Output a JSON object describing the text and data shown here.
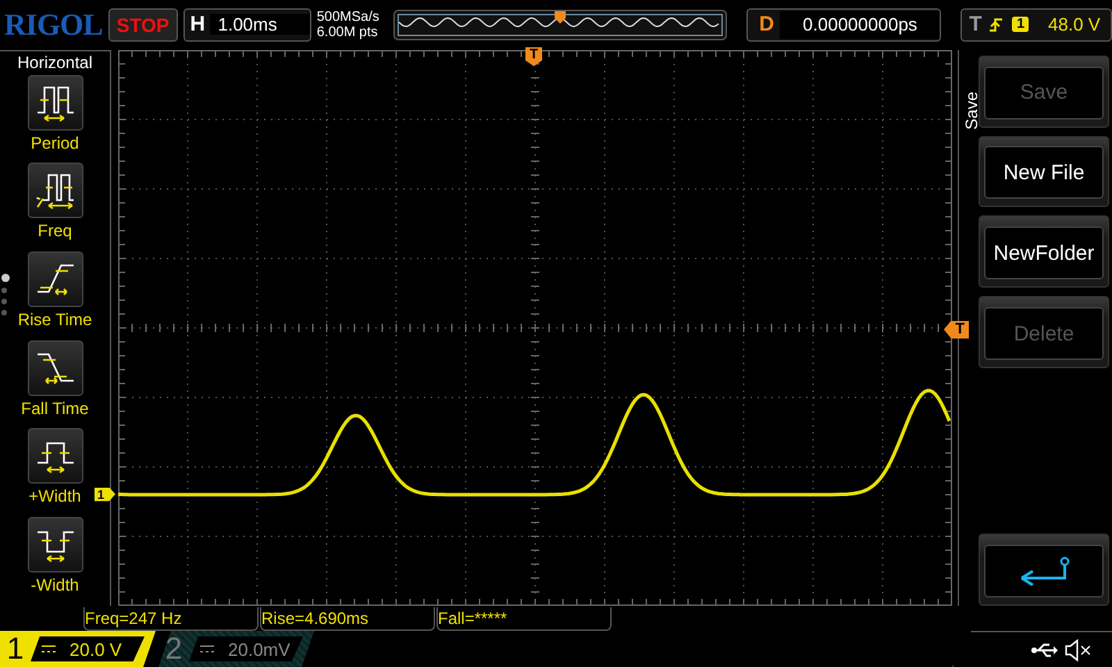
{
  "brand": "RIGOL",
  "run_status": "STOP",
  "horizontal": {
    "label": "H",
    "timebase": "1.00ms"
  },
  "acquisition": {
    "sample_rate": "500MSa/s",
    "memory_depth": "6.00M pts"
  },
  "delay": {
    "label": "D",
    "value": "0.00000000ps"
  },
  "trigger": {
    "label": "T",
    "source": "1",
    "level": "48.0 V"
  },
  "measure_menu": {
    "title": "Horizontal",
    "page_dots": [
      {
        "selected": true
      },
      {
        "selected": false
      },
      {
        "selected": false
      },
      {
        "selected": false
      }
    ],
    "items": [
      {
        "kind": "period",
        "label": "Period"
      },
      {
        "kind": "freq",
        "label": "Freq"
      },
      {
        "kind": "rise",
        "label": "Rise Time"
      },
      {
        "kind": "fall",
        "label": "Fall Time"
      },
      {
        "kind": "pwidth",
        "label": "+Width"
      },
      {
        "kind": "nwidth",
        "label": "-Width"
      }
    ]
  },
  "markers": {
    "trigger_position": "T",
    "trigger_level": "T",
    "channel": "1"
  },
  "measurements": [
    "Freq=247 Hz",
    "Rise=4.690ms",
    "Fall=*****"
  ],
  "softkey_menu": {
    "title": "Save",
    "buttons": [
      {
        "kind": "text",
        "label": "Save",
        "disabled": true
      },
      {
        "kind": "text",
        "label": "New File",
        "disabled": false
      },
      {
        "kind": "text",
        "label": "NewFolder",
        "disabled": false
      },
      {
        "kind": "text",
        "label": "Delete",
        "disabled": true
      },
      {
        "kind": "empty"
      },
      {
        "kind": "back"
      }
    ]
  },
  "channels": [
    {
      "number": "1",
      "scale": "20.0 V",
      "selected": true
    },
    {
      "number": "2",
      "scale": "20.0mV",
      "selected": false
    }
  ]
}
